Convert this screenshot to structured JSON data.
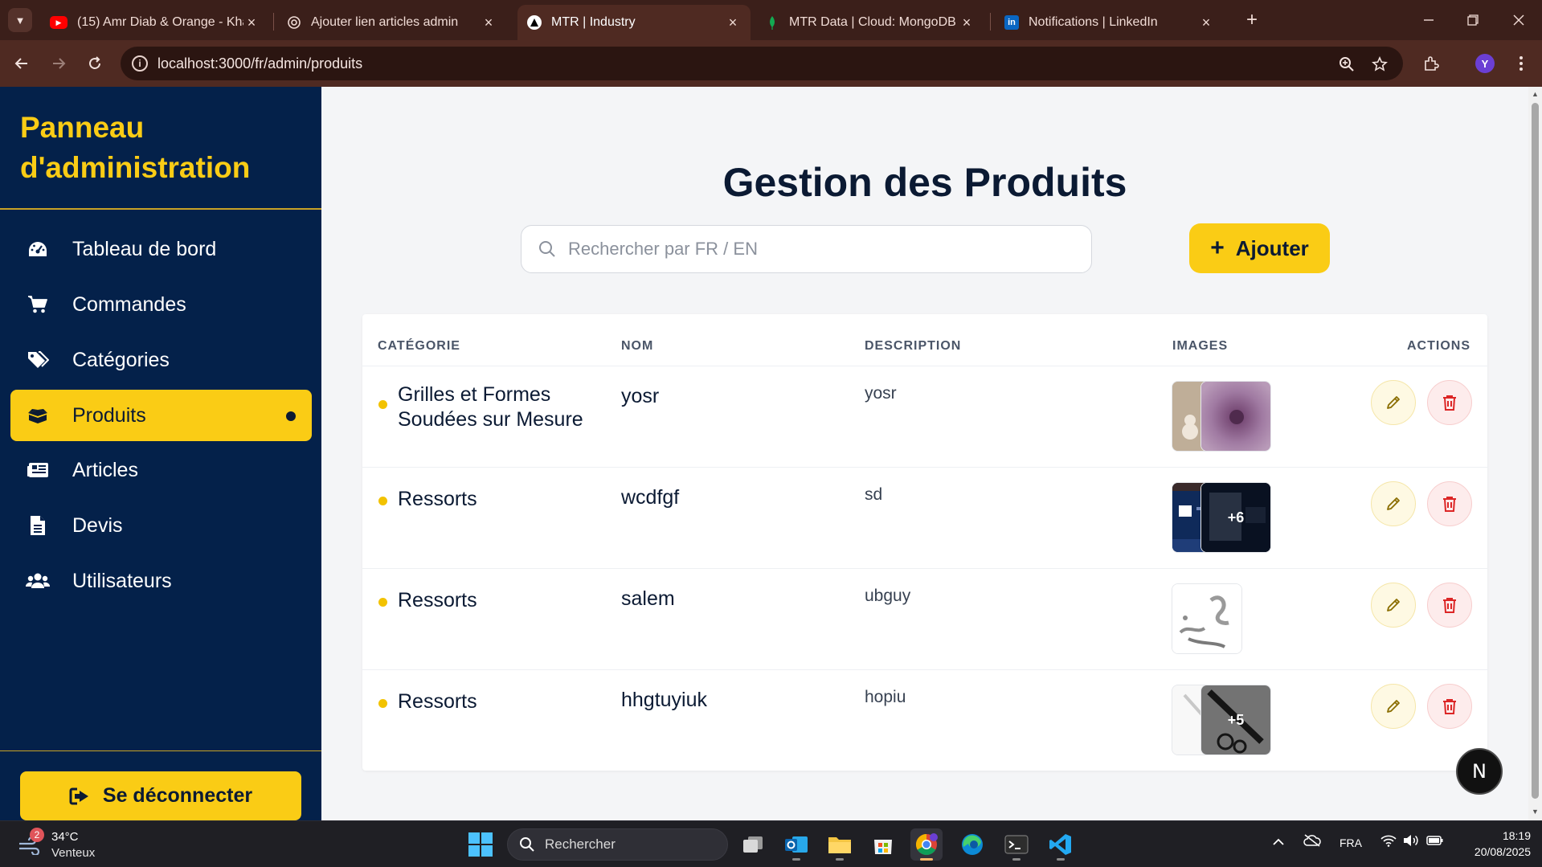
{
  "browser": {
    "tabs": [
      {
        "title": "(15) Amr Diab & Orange - Khatt",
        "icon": "youtube-icon",
        "active": false
      },
      {
        "title": "Ajouter lien articles admin",
        "icon": "chatgpt-icon",
        "active": false
      },
      {
        "title": "MTR | Industry",
        "icon": "triangle-logo-icon",
        "active": true
      },
      {
        "title": "MTR Data | Cloud: MongoDB Cl",
        "icon": "mongodb-leaf-icon",
        "active": false
      },
      {
        "title": "Notifications | LinkedIn",
        "icon": "linkedin-icon",
        "active": false
      }
    ],
    "url": "localhost:3000/fr/admin/produits",
    "profile_initial": "Y"
  },
  "sidebar": {
    "title": "Panneau d'administration",
    "items": [
      {
        "label": "Tableau de bord",
        "icon": "dashboard-gauge-icon",
        "active": false
      },
      {
        "label": "Commandes",
        "icon": "shopping-cart-icon",
        "active": false
      },
      {
        "label": "Catégories",
        "icon": "tags-icon",
        "active": false
      },
      {
        "label": "Produits",
        "icon": "box-open-icon",
        "active": true
      },
      {
        "label": "Articles",
        "icon": "newspaper-icon",
        "active": false
      },
      {
        "label": "Devis",
        "icon": "file-text-icon",
        "active": false
      },
      {
        "label": "Utilisateurs",
        "icon": "users-icon",
        "active": false
      }
    ],
    "logout_label": "Se déconnecter"
  },
  "main": {
    "title": "Gestion des Produits",
    "search_placeholder": "Rechercher par FR / EN",
    "add_label": "Ajouter",
    "columns": [
      "CATÉGORIE",
      "NOM",
      "DESCRIPTION",
      "IMAGES",
      "ACTIONS"
    ],
    "rows": [
      {
        "category": "Grilles et Formes Soudées sur Mesure",
        "name": "yosr",
        "description": "yosr",
        "extra_images": ""
      },
      {
        "category": "Ressorts",
        "name": "wcdfgf",
        "description": "sd",
        "extra_images": "+6"
      },
      {
        "category": "Ressorts",
        "name": "salem",
        "description": "ubguy",
        "extra_images": ""
      },
      {
        "category": "Ressorts",
        "name": "hhgtuyiuk",
        "description": "hopiu",
        "extra_images": "+5"
      }
    ],
    "dev_badge": "N"
  },
  "taskbar": {
    "weather_temp": "34°C",
    "weather_condition": "Venteux",
    "weather_badge": "2",
    "search_label": "Rechercher",
    "language": "FRA",
    "time": "18:19",
    "date": "20/08/2025"
  },
  "colors": {
    "sidebar_bg": "#04214a",
    "accent_yellow": "#facc15",
    "main_bg": "#f4f5f7",
    "browser_frame": "#4f2a22"
  }
}
